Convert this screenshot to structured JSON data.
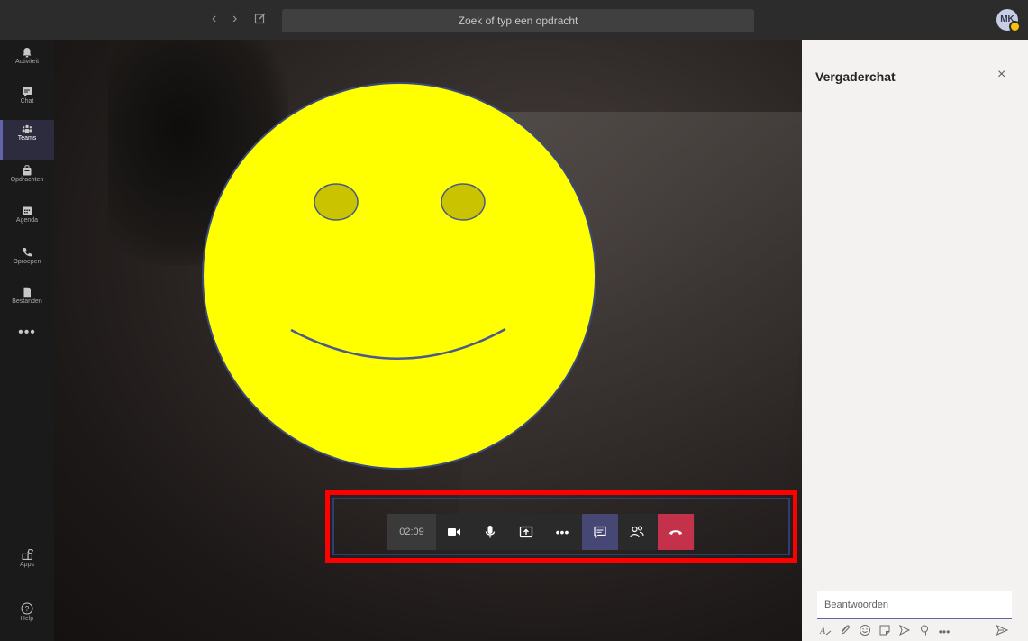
{
  "topbar": {
    "back_icon": "chevron-left-icon",
    "forward_icon": "chevron-right-icon",
    "compose_icon": "compose-icon",
    "search_placeholder": "Zoek of typ een opdracht",
    "avatar_initials": "MK",
    "avatar_status_color": "#f8c10a"
  },
  "rail": {
    "items": [
      {
        "label": "Activiteit",
        "icon": "bell-icon"
      },
      {
        "label": "Chat",
        "icon": "chat-icon"
      },
      {
        "label": "Teams",
        "icon": "teams-icon",
        "active": true
      },
      {
        "label": "Opdrachten",
        "icon": "assignments-icon"
      },
      {
        "label": "Agenda",
        "icon": "calendar-icon"
      },
      {
        "label": "Oproepen",
        "icon": "phone-icon"
      },
      {
        "label": "Bestanden",
        "icon": "file-icon"
      }
    ],
    "more": "•••",
    "apps_label": "Apps",
    "help_label": "Help",
    "accent": "#6264a7"
  },
  "call": {
    "timer": "02:09",
    "controls": [
      "camera-icon",
      "microphone-icon",
      "share-screen-icon",
      "more-icon",
      "chat-toggle-icon",
      "participants-icon",
      "hang-up-icon"
    ],
    "more_glyph": "•••",
    "hangup_color": "#c4314b"
  },
  "annotation": {
    "highlight_color": "#ff0000",
    "smiley_color": "#ffff00"
  },
  "chat": {
    "title": "Vergaderchat",
    "close_glyph": "×",
    "reply_placeholder": "Beantwoorden",
    "more_glyph": "•••"
  }
}
